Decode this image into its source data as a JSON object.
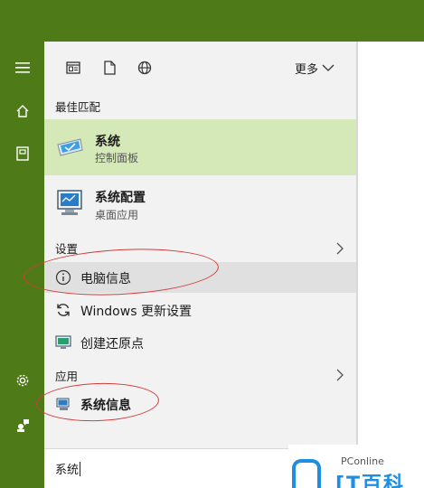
{
  "rail": {
    "icons": [
      "hamburger-icon",
      "home-icon",
      "notebook-icon",
      "settings-icon",
      "feedback-icon"
    ]
  },
  "toolbar": {
    "icons": [
      "apps-filter-icon",
      "documents-filter-icon",
      "web-filter-icon"
    ],
    "more_label": "更多"
  },
  "best_match": {
    "heading": "最佳匹配",
    "items": [
      {
        "title": "系统",
        "subtitle": "控制面板"
      },
      {
        "title": "系统配置",
        "subtitle": "桌面应用"
      }
    ]
  },
  "settings": {
    "heading": "设置",
    "items": [
      "电脑信息",
      "Windows 更新设置",
      "创建还原点"
    ]
  },
  "apps": {
    "heading": "应用",
    "items": [
      "系统信息"
    ]
  },
  "search": {
    "value": "系统"
  },
  "watermark": {
    "brand": "PConline",
    "big": "[T百科"
  },
  "colors": {
    "accent": "#4f7a18",
    "highlight": "#d4e8b8",
    "annotation": "#d23c3c",
    "brand": "#1e8ee0"
  }
}
